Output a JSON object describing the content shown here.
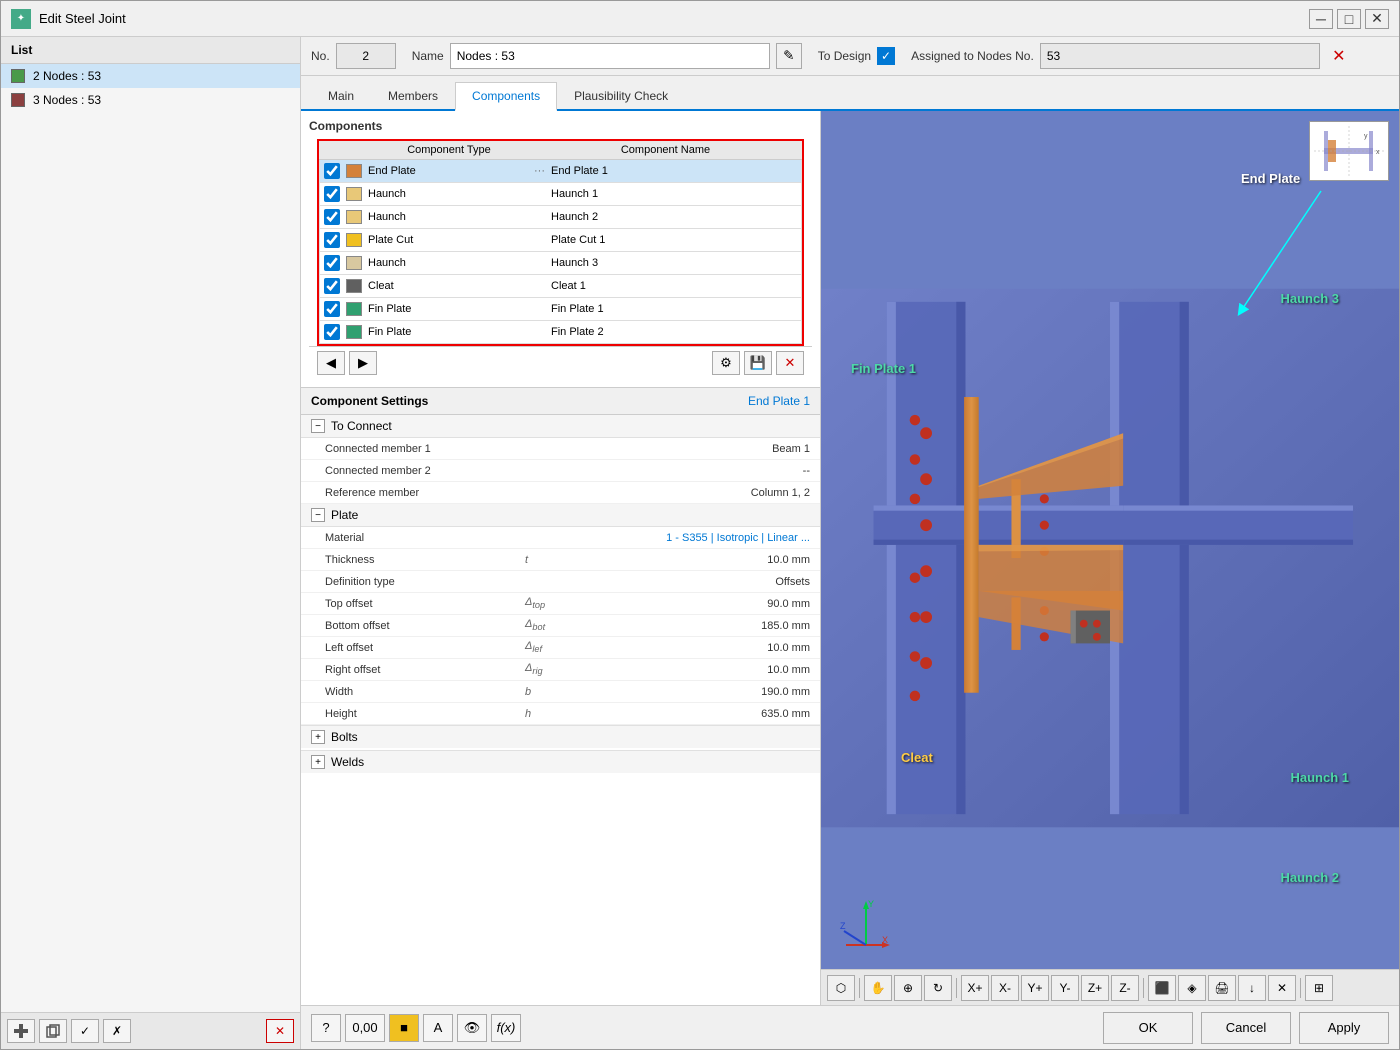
{
  "window": {
    "title": "Edit Steel Joint",
    "icon": "✦"
  },
  "form_header": {
    "no_label": "No.",
    "no_value": "2",
    "name_label": "Name",
    "name_value": "Nodes : 53",
    "to_design_label": "To Design",
    "assigned_label": "Assigned to Nodes No.",
    "assigned_value": "53"
  },
  "tabs": [
    {
      "label": "Main",
      "active": false
    },
    {
      "label": "Members",
      "active": false
    },
    {
      "label": "Components",
      "active": true
    },
    {
      "label": "Plausibility Check",
      "active": false
    }
  ],
  "components_section": {
    "title": "Components",
    "col_type": "Component Type",
    "col_name": "Component Name",
    "items": [
      {
        "checked": true,
        "color": "#d4813a",
        "type": "End Plate",
        "name": "End Plate 1",
        "has_dots": true,
        "selected": true
      },
      {
        "checked": true,
        "color": "#e8c878",
        "type": "Haunch",
        "name": "Haunch 1",
        "has_dots": false,
        "selected": false
      },
      {
        "checked": true,
        "color": "#e8c878",
        "type": "Haunch",
        "name": "Haunch 2",
        "has_dots": false,
        "selected": false
      },
      {
        "checked": true,
        "color": "#f0c020",
        "type": "Plate Cut",
        "name": "Plate Cut 1",
        "has_dots": false,
        "selected": false
      },
      {
        "checked": true,
        "color": "#d8c8a0",
        "type": "Haunch",
        "name": "Haunch 3",
        "has_dots": false,
        "selected": false
      },
      {
        "checked": true,
        "color": "#606060",
        "type": "Cleat",
        "name": "Cleat 1",
        "has_dots": false,
        "selected": false
      },
      {
        "checked": true,
        "color": "#30a070",
        "type": "Fin Plate",
        "name": "Fin Plate 1",
        "has_dots": false,
        "selected": false
      },
      {
        "checked": true,
        "color": "#30a070",
        "type": "Fin Plate",
        "name": "Fin Plate 2",
        "has_dots": false,
        "selected": false
      }
    ]
  },
  "comp_toolbar": {
    "btn_back": "◀",
    "btn_forward": "▶",
    "btn_add": "🔧",
    "btn_save": "💾",
    "btn_delete": "✕"
  },
  "settings": {
    "title": "Component Settings",
    "component_name": "End Plate 1",
    "to_connect_label": "To Connect",
    "connected_member1_label": "Connected member 1",
    "connected_member1_value": "Beam 1",
    "connected_member2_label": "Connected member 2",
    "connected_member2_value": "--",
    "reference_member_label": "Reference member",
    "reference_member_value": "Column 1, 2",
    "plate_label": "Plate",
    "material_label": "Material",
    "material_value": "1 - S355 | Isotropic | Linear ...",
    "thickness_label": "Thickness",
    "thickness_symbol": "t",
    "thickness_value": "10.0 mm",
    "definition_type_label": "Definition type",
    "definition_type_value": "Offsets",
    "top_offset_label": "Top offset",
    "top_offset_symbol": "Δtop",
    "top_offset_value": "90.0 mm",
    "bottom_offset_label": "Bottom offset",
    "bottom_offset_symbol": "Δbot",
    "bottom_offset_value": "185.0 mm",
    "left_offset_label": "Left offset",
    "left_offset_symbol": "Δlef",
    "left_offset_value": "10.0 mm",
    "right_offset_label": "Right offset",
    "right_offset_symbol": "Δrig",
    "right_offset_value": "10.0 mm",
    "width_label": "Width",
    "width_symbol": "b",
    "width_value": "190.0 mm",
    "height_label": "Height",
    "height_symbol": "h",
    "height_value": "635.0 mm",
    "bolts_label": "Bolts",
    "welds_label": "Welds"
  },
  "list": {
    "header": "List",
    "items": [
      {
        "id": "2",
        "label": "2 Nodes : 53",
        "color": "#4a9a4a",
        "selected": true
      },
      {
        "id": "3",
        "label": "3 Nodes : 53",
        "color": "#8b4040",
        "selected": false
      }
    ]
  },
  "scene_labels": {
    "end_plate": "End Plate",
    "fin_plate1": "Fin Plate 1",
    "haunch3": "Haunch 3",
    "cleat": "Cleat",
    "haunch1": "Haunch 1",
    "haunch2": "Haunch 2"
  },
  "bottom_buttons": {
    "ok": "OK",
    "cancel": "Cancel",
    "apply": "Apply"
  },
  "bottom_tools": [
    "?",
    "0,00",
    "■",
    "A",
    "👁",
    "f(x)"
  ]
}
